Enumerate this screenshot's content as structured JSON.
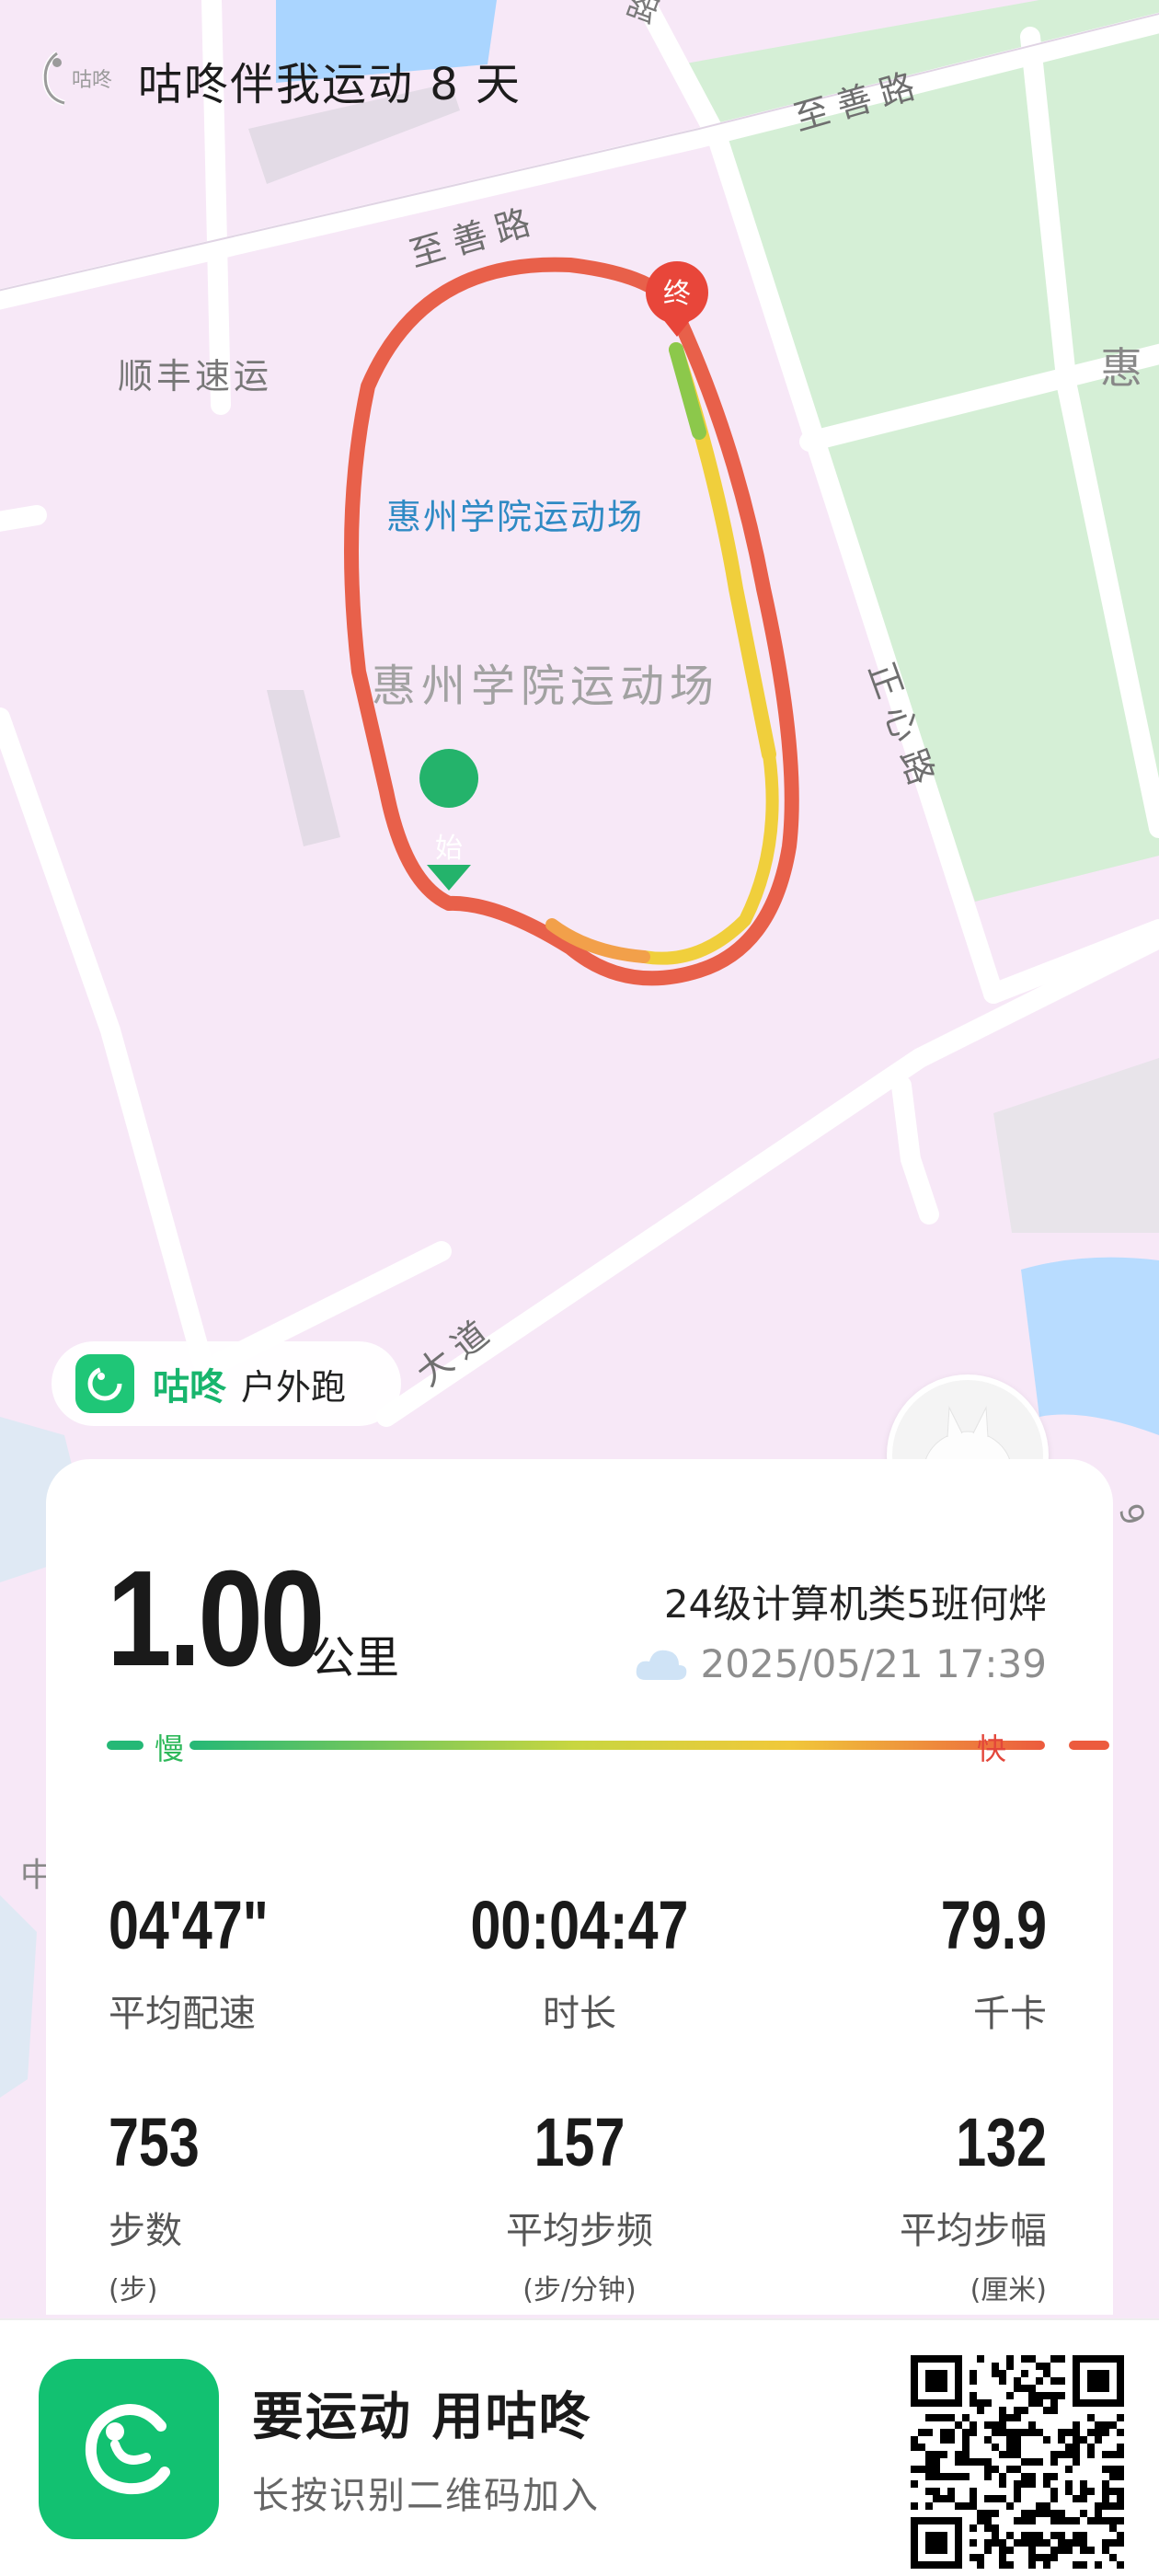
{
  "header": {
    "title": "咕咚伴我运动 8 天",
    "logo_text": "咕咚"
  },
  "map": {
    "labels": {
      "road_top": "路",
      "road_zhishan_1": "至善路",
      "road_zhishan_2": "至善路",
      "place_shunfeng": "顺丰速运",
      "place_venue_blue": "惠州学院运动场",
      "place_venue_gray": "惠州学院运动场",
      "road_zhengxin": "正心路",
      "road_avenue": "大道",
      "edge_hui": "惠",
      "edge_zhong": "中",
      "edge_nine": "9"
    },
    "markers": {
      "start": "始",
      "end": "终"
    },
    "colors": {
      "track_red": "#e8604a",
      "track_yellow": "#f0cf3c",
      "track_green": "#8cc84b",
      "start": "#24b36b",
      "end": "#e8463a"
    }
  },
  "brand_chip": {
    "brand": "咕咚",
    "sport": "户外跑"
  },
  "summary": {
    "distance": "1.00",
    "unit": "公里",
    "user": "24级计算机类5班何烨",
    "datetime": "2025/05/21 17:39",
    "weather_icon": "cloud-icon",
    "slow_label": "慢",
    "fast_label": "快"
  },
  "stats": {
    "pace": {
      "value": "04'47\"",
      "label": "平均配速"
    },
    "duration": {
      "value": "00:04:47",
      "label": "时长"
    },
    "calories": {
      "value": "79.9",
      "label": "千卡"
    },
    "steps": {
      "value": "753",
      "label": "步数",
      "unit": "(步)"
    },
    "cadence": {
      "value": "157",
      "label": "平均步频",
      "unit": "(步/分钟)"
    },
    "stride": {
      "value": "132",
      "label": "平均步幅",
      "unit": "(厘米)"
    }
  },
  "footer": {
    "slogan": "要运动 用咕咚",
    "hint": "长按识别二维码加入"
  }
}
